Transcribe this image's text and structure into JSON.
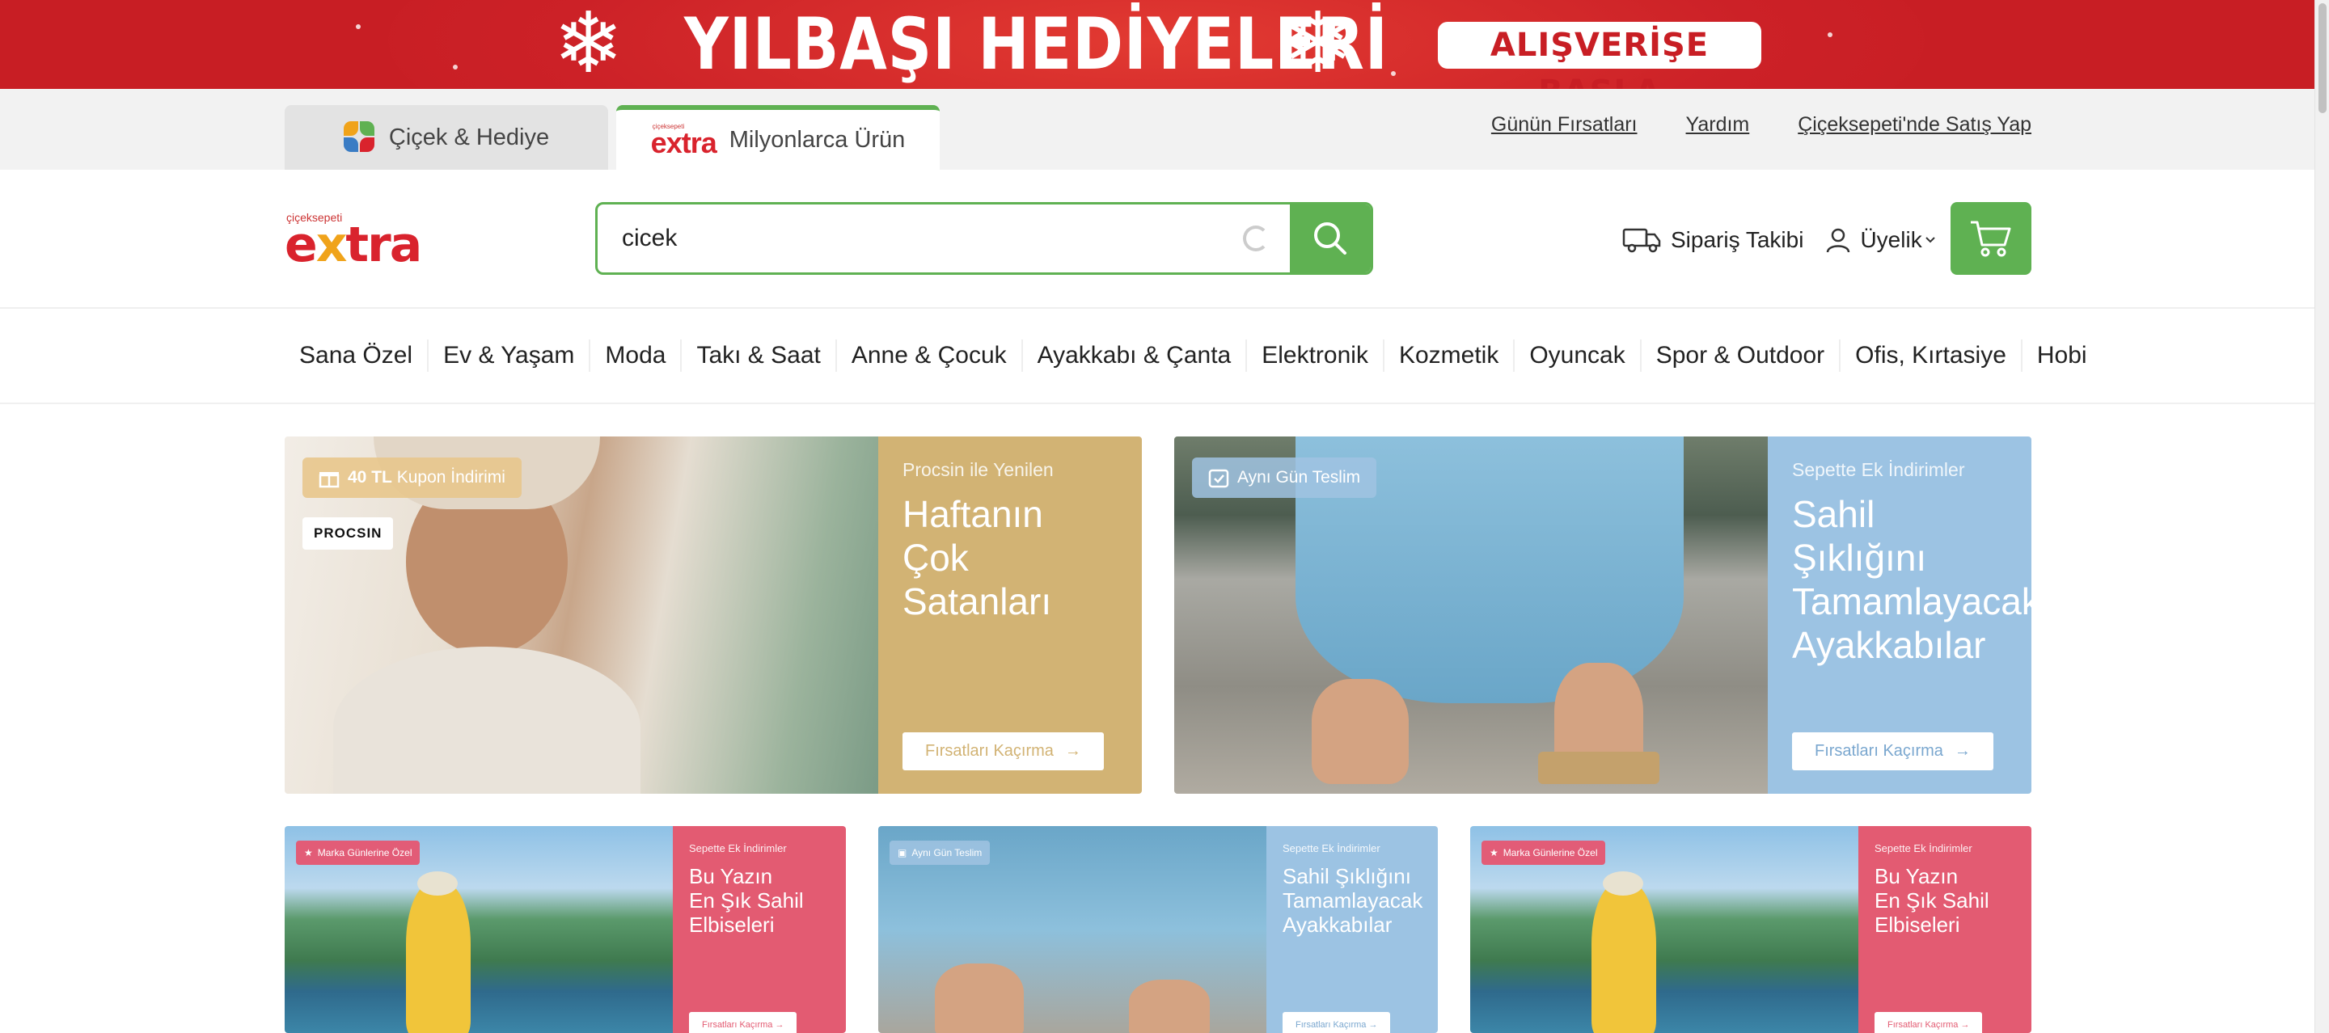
{
  "promo": {
    "title": "YILBAŞI HEDİYELERİ",
    "cta": "ALIŞVERİŞE BAŞLA",
    "bg_color": "#c81e24"
  },
  "site_tabs": [
    {
      "label": "Çiçek & Hediye",
      "icon": "flower-logo-icon"
    },
    {
      "label": "Milyonlarca Ürün",
      "icon": "extra-logo-icon",
      "logo_small_text": "çiçeksepeti",
      "logo_word": "extra"
    }
  ],
  "top_links": [
    "Günün Fırsatları",
    "Yardım",
    "Çiçeksepeti'nde Satış Yap"
  ],
  "logo": {
    "small_text": "çiçeksepeti",
    "word": "extra"
  },
  "search": {
    "value": "cicek",
    "icon": "search-icon"
  },
  "header_actions": {
    "order_tracking": "Sipariş Takibi",
    "membership": "Üyelik",
    "cart_icon": "cart-icon"
  },
  "categories": [
    "Sana Özel",
    "Ev & Yaşam",
    "Moda",
    "Takı & Saat",
    "Anne & Çocuk",
    "Ayakkabı & Çanta",
    "Elektronik",
    "Kozmetik",
    "Oyuncak",
    "Spor & Outdoor",
    "Ofis, Kırtasiye",
    "Hobi"
  ],
  "banners_large": [
    {
      "badge": "40 TL Kupon İndirimi",
      "badge_strong": "40 TL",
      "badge_rest": "Kupon İndirimi",
      "brand": "PROCSIN",
      "subtitle": "Procsin ile Yenilen",
      "title_lines": [
        "Haftanın",
        "Çok Satanları"
      ],
      "button": "Fırsatları Kaçırma",
      "panel_color": "#d2b374"
    },
    {
      "badge": "Aynı Gün Teslim",
      "subtitle": "Sepette Ek İndirimler",
      "title_lines": [
        "Sahil Şıklığını",
        "Tamamlayacak",
        "Ayakkabılar"
      ],
      "button": "Fırsatları Kaçırma",
      "panel_color": "#9cc3e3"
    }
  ],
  "banners_small": [
    {
      "badge": "Marka Günlerine Özel",
      "subtitle": "Sepette Ek İndirimler",
      "title_lines": [
        "Bu Yazın",
        "En Şık Sahil",
        "Elbiseleri"
      ],
      "button": "Fırsatları Kaçırma",
      "panel_color": "#e35b72"
    },
    {
      "badge": "Aynı Gün Teslim",
      "subtitle": "Sepette Ek İndirimler",
      "title_lines": [
        "Sahil Şıklığını",
        "Tamamlayacak",
        "Ayakkabılar"
      ],
      "button": "Fırsatları Kaçırma",
      "panel_color": "#9cc3e3"
    },
    {
      "badge": "Marka Günlerine Özel",
      "subtitle": "Sepette Ek İndirimler",
      "title_lines": [
        "Bu Yazın",
        "En Şık Sahil",
        "Elbiseleri"
      ],
      "button": "Fırsatları Kaçırma",
      "panel_color": "#e35b72"
    }
  ]
}
